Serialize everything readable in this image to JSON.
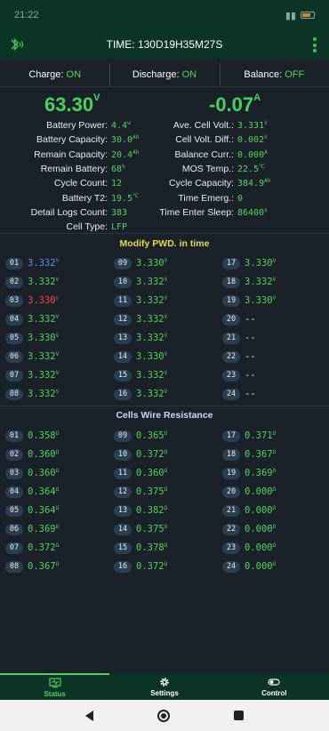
{
  "statusbar": {
    "time": "21:22"
  },
  "appbar": {
    "title": "TIME: 130D19H35M27S"
  },
  "toggles": {
    "charge_label": "Charge:",
    "charge_value": "ON",
    "discharge_label": "Discharge:",
    "discharge_value": "ON",
    "balance_label": "Balance:",
    "balance_value": "OFF"
  },
  "voltage": {
    "value": "63.30",
    "unit": "V"
  },
  "current": {
    "value": "-0.07",
    "unit": "A"
  },
  "left_params": [
    {
      "label": "Battery Power:",
      "value": "4.4",
      "unit": "w"
    },
    {
      "label": "Battery Capacity:",
      "value": "30.0",
      "unit": "Ah"
    },
    {
      "label": "Remain Capacity:",
      "value": "20.4",
      "unit": "Ah"
    },
    {
      "label": "Remain Battery:",
      "value": "68",
      "unit": "%"
    },
    {
      "label": "Cycle Count:",
      "value": "12",
      "unit": ""
    },
    {
      "label": "Battery T2:",
      "value": "19.5",
      "unit": "℃"
    },
    {
      "label": "Detail Logs Count:",
      "value": "383",
      "unit": ""
    },
    {
      "label": "Cell Type:",
      "value": "LFP",
      "unit": ""
    }
  ],
  "right_params": [
    {
      "label": "Ave. Cell Volt.:",
      "value": "3.331",
      "unit": "V"
    },
    {
      "label": "Cell Volt. Diff.:",
      "value": "0.002",
      "unit": "V"
    },
    {
      "label": "Balance Curr.:",
      "value": "0.000",
      "unit": "A"
    },
    {
      "label": "MOS Temp.:",
      "value": "22.5",
      "unit": "℃"
    },
    {
      "label": "Cycle Capacity:",
      "value": "384.9",
      "unit": "Ah"
    },
    {
      "label": "Time Emerg.:",
      "value": "0",
      "unit": ""
    },
    {
      "label": "Time Enter Sleep:",
      "value": "86400",
      "unit": "s"
    }
  ],
  "pwd_title": "Modify PWD. in time",
  "cells_voltage": [
    {
      "id": "01",
      "value": "3.332",
      "unit": "V",
      "state": "max"
    },
    {
      "id": "02",
      "value": "3.332",
      "unit": "V",
      "state": ""
    },
    {
      "id": "03",
      "value": "3.330",
      "unit": "V",
      "state": "min"
    },
    {
      "id": "04",
      "value": "3.332",
      "unit": "V",
      "state": ""
    },
    {
      "id": "05",
      "value": "3.330",
      "unit": "V",
      "state": ""
    },
    {
      "id": "06",
      "value": "3.332",
      "unit": "V",
      "state": ""
    },
    {
      "id": "07",
      "value": "3.332",
      "unit": "V",
      "state": ""
    },
    {
      "id": "08",
      "value": "3.332",
      "unit": "V",
      "state": ""
    },
    {
      "id": "09",
      "value": "3.330",
      "unit": "V",
      "state": ""
    },
    {
      "id": "10",
      "value": "3.332",
      "unit": "V",
      "state": ""
    },
    {
      "id": "11",
      "value": "3.332",
      "unit": "V",
      "state": ""
    },
    {
      "id": "12",
      "value": "3.332",
      "unit": "V",
      "state": ""
    },
    {
      "id": "13",
      "value": "3.332",
      "unit": "V",
      "state": ""
    },
    {
      "id": "14",
      "value": "3.330",
      "unit": "V",
      "state": ""
    },
    {
      "id": "15",
      "value": "3.332",
      "unit": "V",
      "state": ""
    },
    {
      "id": "16",
      "value": "3.332",
      "unit": "V",
      "state": ""
    },
    {
      "id": "17",
      "value": "3.330",
      "unit": "V",
      "state": ""
    },
    {
      "id": "18",
      "value": "3.332",
      "unit": "V",
      "state": ""
    },
    {
      "id": "19",
      "value": "3.330",
      "unit": "V",
      "state": ""
    },
    {
      "id": "20",
      "value": "--",
      "unit": "",
      "state": "none"
    },
    {
      "id": "21",
      "value": "--",
      "unit": "",
      "state": "none"
    },
    {
      "id": "22",
      "value": "--",
      "unit": "",
      "state": "none"
    },
    {
      "id": "23",
      "value": "--",
      "unit": "",
      "state": "none"
    },
    {
      "id": "24",
      "value": "--",
      "unit": "",
      "state": "none"
    }
  ],
  "res_title": "Cells Wire Resistance",
  "cells_resistance": [
    {
      "id": "01",
      "value": "0.358",
      "unit": "Ω"
    },
    {
      "id": "02",
      "value": "0.360",
      "unit": "Ω"
    },
    {
      "id": "03",
      "value": "0.360",
      "unit": "Ω"
    },
    {
      "id": "04",
      "value": "0.364",
      "unit": "Ω"
    },
    {
      "id": "05",
      "value": "0.364",
      "unit": "Ω"
    },
    {
      "id": "06",
      "value": "0.369",
      "unit": "Ω"
    },
    {
      "id": "07",
      "value": "0.372",
      "unit": "Ω"
    },
    {
      "id": "08",
      "value": "0.367",
      "unit": "Ω"
    },
    {
      "id": "09",
      "value": "0.365",
      "unit": "Ω"
    },
    {
      "id": "10",
      "value": "0.372",
      "unit": "Ω"
    },
    {
      "id": "11",
      "value": "0.360",
      "unit": "Ω"
    },
    {
      "id": "12",
      "value": "0.375",
      "unit": "Ω"
    },
    {
      "id": "13",
      "value": "0.382",
      "unit": "Ω"
    },
    {
      "id": "14",
      "value": "0.375",
      "unit": "Ω"
    },
    {
      "id": "15",
      "value": "0.378",
      "unit": "Ω"
    },
    {
      "id": "16",
      "value": "0.372",
      "unit": "Ω"
    },
    {
      "id": "17",
      "value": "0.371",
      "unit": "Ω"
    },
    {
      "id": "18",
      "value": "0.367",
      "unit": "Ω"
    },
    {
      "id": "19",
      "value": "0.369",
      "unit": "Ω"
    },
    {
      "id": "20",
      "value": "0.000",
      "unit": "Ω"
    },
    {
      "id": "21",
      "value": "0.000",
      "unit": "Ω"
    },
    {
      "id": "22",
      "value": "0.000",
      "unit": "Ω"
    },
    {
      "id": "23",
      "value": "0.000",
      "unit": "Ω"
    },
    {
      "id": "24",
      "value": "0.000",
      "unit": "Ω"
    }
  ],
  "tabs": [
    {
      "label": "Status",
      "icon": "monitor-icon",
      "active": true
    },
    {
      "label": "Settings",
      "icon": "gear-icon",
      "active": false
    },
    {
      "label": "Control",
      "icon": "toggle-icon",
      "active": false
    }
  ],
  "colors": {
    "accent": "#4fd35e",
    "max_cell": "#5b8cff",
    "min_cell": "#ff4040",
    "header_bg": "#0b3326"
  }
}
